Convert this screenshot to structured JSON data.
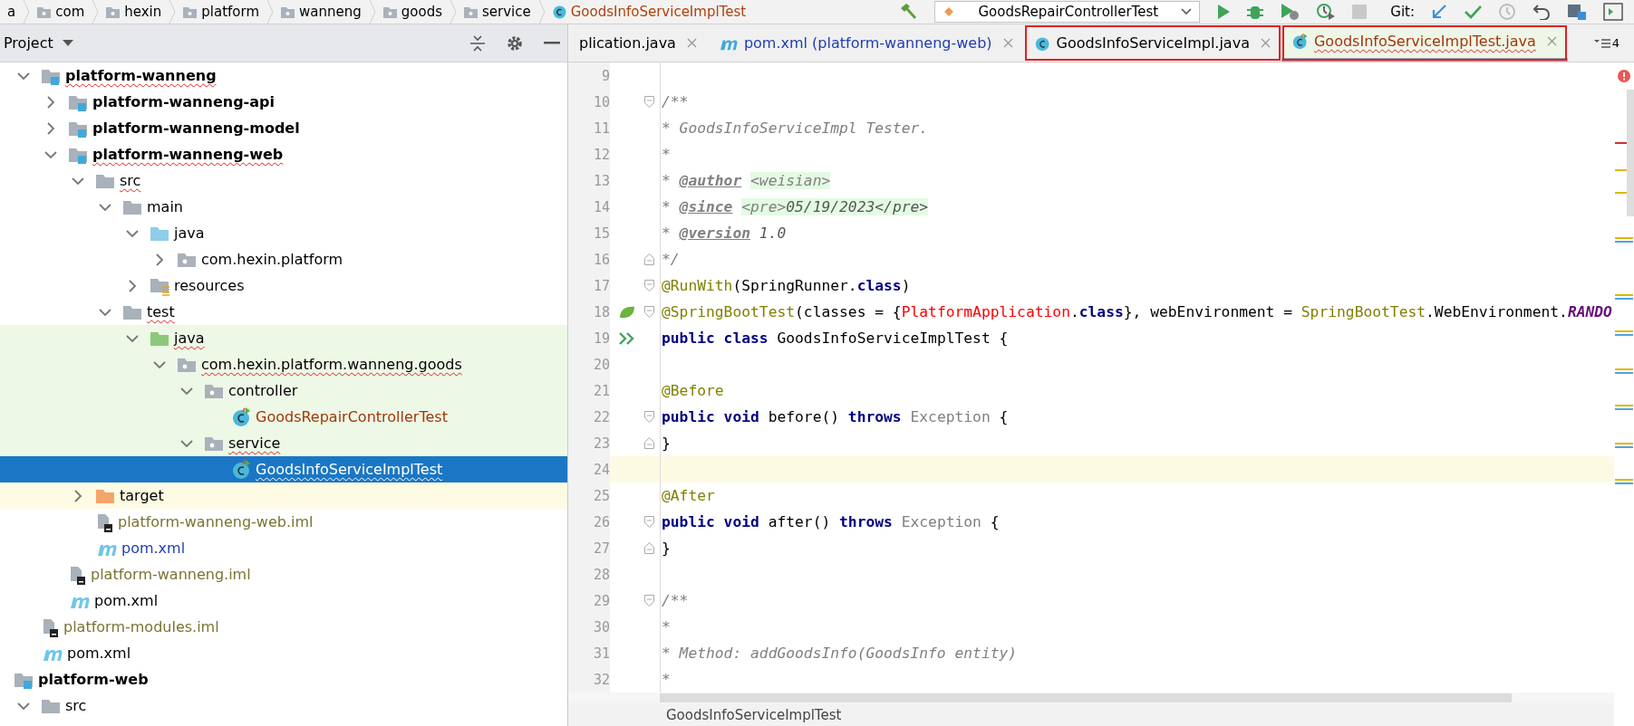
{
  "navbar": {
    "breadcrumbs": [
      {
        "label": "a",
        "kind": "fragment"
      },
      {
        "label": "com",
        "kind": "package"
      },
      {
        "label": "hexin",
        "kind": "package"
      },
      {
        "label": "platform",
        "kind": "package"
      },
      {
        "label": "wanneng",
        "kind": "package"
      },
      {
        "label": "goods",
        "kind": "package"
      },
      {
        "label": "service",
        "kind": "package"
      },
      {
        "label": "GoodsInfoServiceImplTest",
        "kind": "class"
      }
    ],
    "run_configuration": "GoodsRepairControllerTest",
    "vcs_label": "Git:"
  },
  "project_panel": {
    "title": "Project",
    "tree": {
      "scrolled_branch": [
        {
          "label": "platform-wanneng",
          "kind": "module",
          "typo": true,
          "selected": false,
          "expanded": true,
          "children": [
            {
              "label": "platform-wanneng-api",
              "kind": "module",
              "typo": false,
              "selected": false,
              "expanded": false
            },
            {
              "label": "platform-wanneng-model",
              "kind": "module",
              "typo": false,
              "selected": false,
              "expanded": false
            },
            {
              "label": "platform-wanneng-web",
              "kind": "module",
              "typo": true,
              "selected": false,
              "expanded": true,
              "children": [
                {
                  "label": "src",
                  "kind": "folder",
                  "typo": true,
                  "selected": false,
                  "expanded": true,
                  "children": [
                    {
                      "label": "main",
                      "kind": "folder",
                      "typo": false,
                      "selected": false,
                      "expanded": true,
                      "children": [
                        {
                          "label": "java",
                          "kind": "source",
                          "typo": false,
                          "selected": false,
                          "expanded": true,
                          "children": [
                            {
                              "label": "com.hexin.platform",
                              "kind": "package",
                              "typo": false,
                              "selected": false,
                              "expanded": false
                            }
                          ]
                        },
                        {
                          "label": "resources",
                          "kind": "resources",
                          "typo": false,
                          "selected": false,
                          "expanded": false
                        }
                      ]
                    },
                    {
                      "label": "test",
                      "kind": "folder",
                      "typo": true,
                      "selected": false,
                      "expanded": true,
                      "children": [
                        {
                          "label": "java",
                          "kind": "test-source",
                          "typo": true,
                          "selected": false,
                          "expanded": true,
                          "children": [
                            {
                              "label": "com.hexin.platform.wanneng.goods",
                              "kind": "package",
                              "typo": true,
                              "selected": false,
                              "expanded": true,
                              "children": [
                                {
                                  "label": "controller",
                                  "kind": "package",
                                  "typo": false,
                                  "selected": false,
                                  "expanded": true,
                                  "children": [
                                    {
                                      "label": "GoodsRepairControllerTest",
                                      "kind": "class",
                                      "color": "#a0380a",
                                      "typo": false,
                                      "selected": false
                                    }
                                  ]
                                },
                                {
                                  "label": "service",
                                  "kind": "package",
                                  "typo": true,
                                  "selected": false,
                                  "expanded": true,
                                  "children": [
                                    {
                                      "label": "GoodsInfoServiceImplTest",
                                      "kind": "class",
                                      "typo": true,
                                      "selected": true
                                    }
                                  ]
                                }
                              ]
                            }
                          ]
                        }
                      ]
                    }
                  ]
                },
                {
                  "label": "target",
                  "kind": "excluded",
                  "typo": false,
                  "selected": false,
                  "expanded": false
                },
                {
                  "label": "platform-wanneng-web.iml",
                  "kind": "iml",
                  "color": "#7a7433",
                  "typo": false,
                  "selected": false
                },
                {
                  "label": "pom.xml",
                  "kind": "maven",
                  "color": "#1f3fb0",
                  "typo": false,
                  "selected": false
                }
              ]
            },
            {
              "label": "platform-wanneng.iml",
              "kind": "iml",
              "color": "#7a7433",
              "typo": false,
              "selected": false
            },
            {
              "label": "pom.xml",
              "kind": "maven",
              "typo": false,
              "selected": false
            }
          ]
        },
        {
          "label": "platform-modules.iml",
          "kind": "iml",
          "color": "#7a7433",
          "typo": false,
          "selected": false
        },
        {
          "label": "pom.xml",
          "kind": "maven",
          "typo": false,
          "selected": false
        }
      ],
      "roots": [
        {
          "label": "platform-web",
          "kind": "module",
          "typo": false,
          "selected": false,
          "children": [
            {
              "label": "src",
              "kind": "folder",
              "typo": false,
              "selected": false,
              "expanded": true
            }
          ]
        }
      ]
    }
  },
  "editor": {
    "tabs": [
      {
        "label": "plication.java",
        "kind": "java",
        "selected": false,
        "highlighted": false
      },
      {
        "label": "pom.xml (platform-wanneng-web)",
        "kind": "maven",
        "color": "#1f3fb0",
        "selected": false,
        "highlighted": false
      },
      {
        "label": "GoodsInfoServiceImpl.java",
        "kind": "class",
        "selected": false,
        "highlighted": true
      },
      {
        "label": "GoodsInfoServiceImplTest.java",
        "kind": "test-class",
        "color": "#a0380a",
        "selected": true,
        "highlighted": true
      }
    ],
    "hidden_tabs_count": "4",
    "lines": [
      {
        "number": "9",
        "current": false,
        "fold_start": false,
        "fold_end": false,
        "spring_bean": false,
        "runnable": false
      },
      {
        "number": "10",
        "fold_start": true,
        "fold_end": false,
        "spring_bean": false,
        "runnable": false,
        "current": false,
        "tokens": [
          {
            "text": "/**",
            "kind": "doc"
          }
        ]
      },
      {
        "number": "11",
        "fold_start": false,
        "fold_end": false,
        "spring_bean": false,
        "runnable": false,
        "current": false,
        "tokens": [
          {
            "text": "* GoodsInfoServiceImpl Tester.",
            "kind": "doc"
          }
        ]
      },
      {
        "number": "12",
        "fold_start": false,
        "fold_end": false,
        "spring_bean": false,
        "runnable": false,
        "current": false,
        "tokens": [
          {
            "text": "*",
            "kind": "doc"
          }
        ]
      },
      {
        "number": "13",
        "fold_start": false,
        "fold_end": false,
        "spring_bean": false,
        "runnable": false,
        "current": false,
        "tokens": [
          {
            "text": "* ",
            "kind": "doc"
          },
          {
            "text": "@author",
            "kind": "doctag"
          },
          {
            "text": "<weisian>",
            "kind": "doc-markup"
          }
        ]
      },
      {
        "number": "14",
        "fold_start": false,
        "fold_end": false,
        "spring_bean": false,
        "runnable": false,
        "current": false,
        "tokens": [
          {
            "text": "* ",
            "kind": "doc"
          },
          {
            "text": "@since",
            "kind": "doctag"
          },
          {
            "text": "<pre>",
            "kind": "doc-markup"
          },
          {
            "text": "05/19/2023",
            "kind": "doc-code"
          },
          {
            "text": "</pre>",
            "kind": "doc-code"
          }
        ]
      },
      {
        "number": "15",
        "fold_start": false,
        "fold_end": false,
        "spring_bean": false,
        "runnable": false,
        "current": false,
        "tokens": [
          {
            "text": "* ",
            "kind": "doc"
          },
          {
            "text": "@version",
            "kind": "doctag"
          },
          {
            "text": "1.0",
            "kind": "doc-value"
          }
        ]
      },
      {
        "number": "16",
        "fold_start": false,
        "fold_end": true,
        "spring_bean": false,
        "runnable": false,
        "current": false,
        "tokens": [
          {
            "text": "*/",
            "kind": "doc"
          }
        ]
      },
      {
        "number": "17",
        "fold_start": true,
        "fold_end": false,
        "spring_bean": false,
        "runnable": false,
        "current": false,
        "tokens": [
          {
            "text": "@RunWith",
            "kind": "annotation"
          },
          {
            "text": "(SpringRunner.",
            "kind": "plain"
          },
          {
            "text": "class",
            "kind": "keyword"
          },
          {
            "text": ")",
            "kind": "plain"
          }
        ]
      },
      {
        "number": "18",
        "fold_start": true,
        "fold_end": false,
        "spring_bean": true,
        "runnable": false,
        "current": false,
        "tokens": [
          {
            "text": "@SpringBootTest",
            "kind": "annotation"
          },
          {
            "text": "(classes = {",
            "kind": "plain"
          },
          {
            "text": "PlatformApplication",
            "kind": "error"
          },
          {
            "text": ".",
            "kind": "plain"
          },
          {
            "text": "class",
            "kind": "keyword"
          },
          {
            "text": "}, webEnvironment = ",
            "kind": "plain"
          },
          {
            "text": "SpringBootTest",
            "kind": "type"
          },
          {
            "text": ".WebEnvironment.",
            "kind": "plain"
          },
          {
            "text": "RANDO",
            "kind": "constant"
          }
        ]
      },
      {
        "number": "19",
        "fold_start": false,
        "fold_end": false,
        "spring_bean": false,
        "runnable": true,
        "current": false,
        "tokens": [
          {
            "text": "public class",
            "kind": "keyword"
          },
          {
            "text": " GoodsInfoServiceImplTest {",
            "kind": "plain"
          }
        ]
      },
      {
        "number": "20",
        "fold_start": false,
        "fold_end": false,
        "spring_bean": false,
        "runnable": false,
        "current": false
      },
      {
        "number": "21",
        "fold_start": false,
        "fold_end": false,
        "spring_bean": false,
        "runnable": false,
        "current": false,
        "tokens": [
          {
            "text": "@Before",
            "kind": "annotation"
          }
        ]
      },
      {
        "number": "22",
        "fold_start": true,
        "fold_end": false,
        "spring_bean": false,
        "runnable": false,
        "current": false,
        "tokens": [
          {
            "text": "public void",
            "kind": "keyword"
          },
          {
            "text": " before() ",
            "kind": "plain"
          },
          {
            "text": "throws",
            "kind": "keyword"
          },
          {
            "text": " Exception",
            "kind": "unused"
          },
          {
            "text": " {",
            "kind": "plain"
          }
        ]
      },
      {
        "number": "23",
        "fold_start": false,
        "fold_end": true,
        "spring_bean": false,
        "runnable": false,
        "current": false,
        "tokens": [
          {
            "text": "}",
            "kind": "plain"
          }
        ]
      },
      {
        "number": "24",
        "fold_start": false,
        "fold_end": false,
        "spring_bean": false,
        "runnable": false,
        "current": true
      },
      {
        "number": "25",
        "fold_start": false,
        "fold_end": false,
        "spring_bean": false,
        "runnable": false,
        "current": false,
        "tokens": [
          {
            "text": "@After",
            "kind": "annotation"
          }
        ]
      },
      {
        "number": "26",
        "fold_start": true,
        "fold_end": false,
        "spring_bean": false,
        "runnable": false,
        "current": false,
        "tokens": [
          {
            "text": "public void",
            "kind": "keyword"
          },
          {
            "text": " after() ",
            "kind": "plain"
          },
          {
            "text": "throws",
            "kind": "keyword"
          },
          {
            "text": " Exception",
            "kind": "unused"
          },
          {
            "text": " {",
            "kind": "plain"
          }
        ]
      },
      {
        "number": "27",
        "fold_start": false,
        "fold_end": true,
        "spring_bean": false,
        "runnable": false,
        "current": false,
        "tokens": [
          {
            "text": "}",
            "kind": "plain"
          }
        ]
      },
      {
        "number": "28",
        "fold_start": false,
        "fold_end": false,
        "spring_bean": false,
        "runnable": false,
        "current": false
      },
      {
        "number": "29",
        "fold_start": true,
        "fold_end": false,
        "spring_bean": false,
        "runnable": false,
        "current": false,
        "tokens": [
          {
            "text": "/**",
            "kind": "doc"
          }
        ]
      },
      {
        "number": "30",
        "fold_start": false,
        "fold_end": false,
        "spring_bean": false,
        "runnable": false,
        "current": false,
        "tokens": [
          {
            "text": "*",
            "kind": "doc"
          }
        ]
      },
      {
        "number": "31",
        "fold_start": false,
        "fold_end": false,
        "spring_bean": false,
        "runnable": false,
        "current": false,
        "tokens": [
          {
            "text": "* Method: addGoodsInfo(GoodsInfo entity)",
            "kind": "doc"
          }
        ]
      },
      {
        "number": "32",
        "fold_start": false,
        "fold_end": false,
        "spring_bean": false,
        "runnable": false,
        "current": false,
        "tokens": [
          {
            "text": "*",
            "kind": "doc"
          }
        ]
      }
    ],
    "breadcrumb": "GoodsInfoServiceImplTest"
  }
}
